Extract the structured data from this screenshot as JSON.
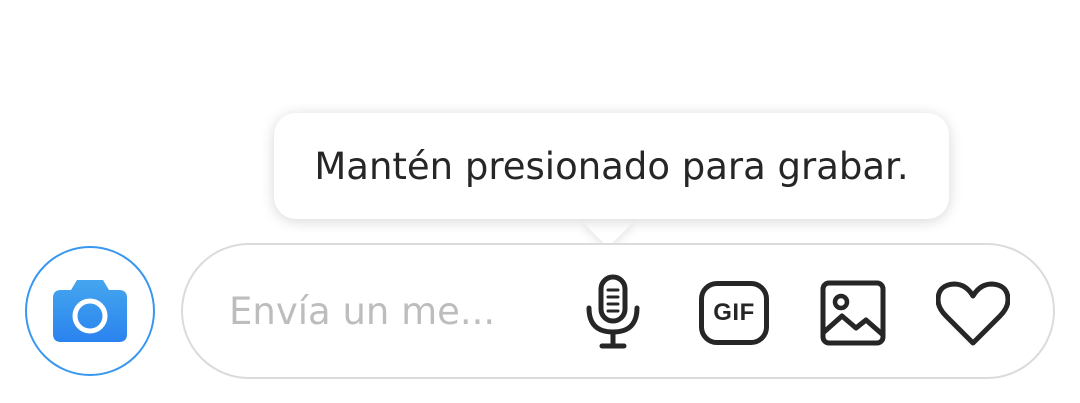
{
  "tooltip": {
    "text": "Mantén presionado para grabar."
  },
  "composer": {
    "placeholder": "Envía un me...",
    "gif_label": "GIF"
  },
  "icons": {
    "camera": "camera-icon",
    "microphone": "microphone-icon",
    "gif": "gif-icon",
    "image": "image-icon",
    "heart": "heart-icon"
  },
  "colors": {
    "accent": "#3897f0",
    "camera_fill_top": "#45a6ee",
    "camera_fill_bottom": "#2a83ef",
    "icon": "#262626",
    "placeholder": "#bdbdbd",
    "border": "#dbdbdb"
  }
}
